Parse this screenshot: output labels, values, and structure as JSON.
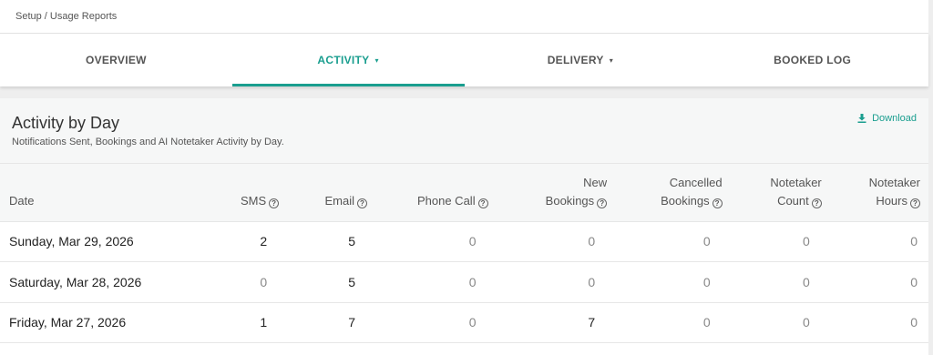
{
  "breadcrumb": "Setup / Usage Reports",
  "tabs": [
    {
      "label": "OVERVIEW",
      "caret": ""
    },
    {
      "label": "ACTIVITY",
      "caret": "▾"
    },
    {
      "label": "DELIVERY",
      "caret": "▾"
    },
    {
      "label": "BOOKED LOG",
      "caret": ""
    }
  ],
  "colors": {
    "accent": "#1a9e8f"
  },
  "card": {
    "title": "Activity by Day",
    "subtitle": "Notifications Sent, Bookings and AI Notetaker Activity by Day.",
    "download_label": "Download",
    "download_icon": "download-icon"
  },
  "table": {
    "help_glyph": "?",
    "columns": [
      {
        "line1": "",
        "line2": "Date"
      },
      {
        "line1": "",
        "line2": "SMS"
      },
      {
        "line1": "",
        "line2": "Email"
      },
      {
        "line1": "",
        "line2": "Phone Call"
      },
      {
        "line1": "New",
        "line2": "Bookings"
      },
      {
        "line1": "Cancelled",
        "line2": "Bookings"
      },
      {
        "line1": "Notetaker",
        "line2": "Count"
      },
      {
        "line1": "Notetaker",
        "line2": "Hours"
      }
    ],
    "rows": [
      {
        "date": "Sunday, Mar 29, 2026",
        "sms": "2",
        "email": "5",
        "phone": "0",
        "new": "0",
        "cancelled": "0",
        "nt_count": "0",
        "nt_hours": "0"
      },
      {
        "date": "Saturday, Mar 28, 2026",
        "sms": "0",
        "email": "5",
        "phone": "0",
        "new": "0",
        "cancelled": "0",
        "nt_count": "0",
        "nt_hours": "0"
      },
      {
        "date": "Friday, Mar 27, 2026",
        "sms": "1",
        "email": "7",
        "phone": "0",
        "new": "7",
        "cancelled": "0",
        "nt_count": "0",
        "nt_hours": "0"
      }
    ]
  }
}
